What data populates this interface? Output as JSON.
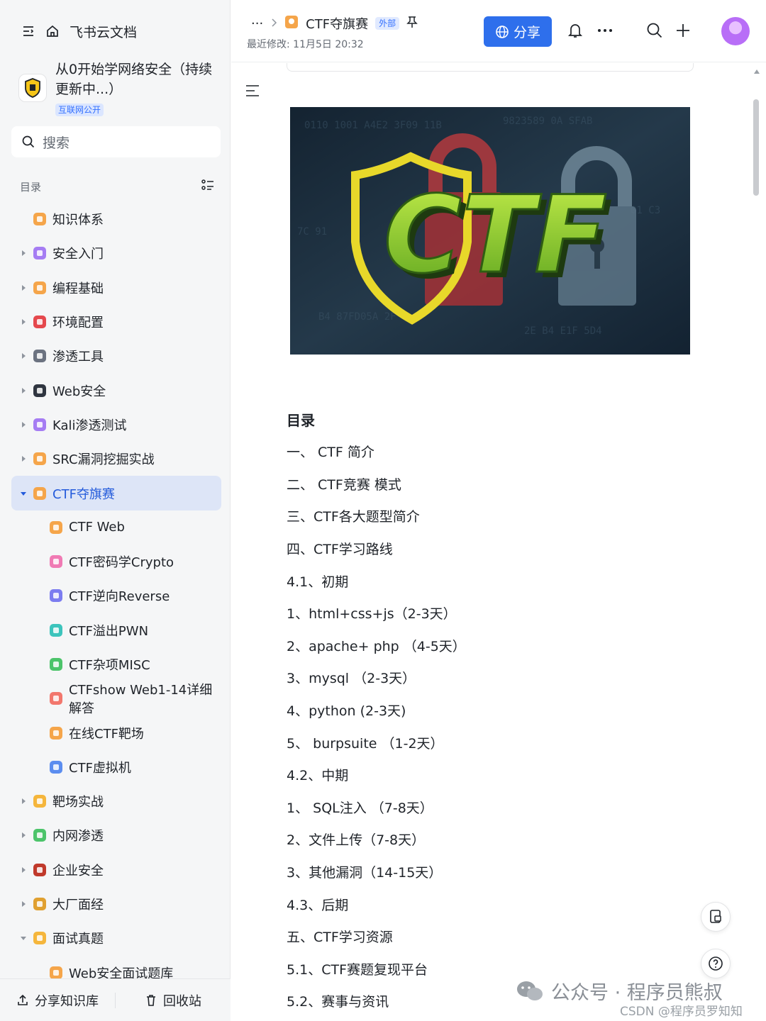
{
  "sidebar": {
    "home_label": "飞书云文档",
    "kb_title": "从0开始学网络安全（持续更新中...）",
    "kb_tag": "互联网公开",
    "search_placeholder": "搜索",
    "toc_label": "目录",
    "items": [
      {
        "label": "知识体系",
        "color": "#f5a54a",
        "arrow": "none",
        "indent": 0
      },
      {
        "label": "安全入门",
        "color": "#a57cf3",
        "arrow": "right",
        "indent": 0
      },
      {
        "label": "编程基础",
        "color": "#f5a54a",
        "arrow": "right",
        "indent": 0
      },
      {
        "label": "环境配置",
        "color": "#e5484d",
        "arrow": "right",
        "indent": 0
      },
      {
        "label": "渗透工具",
        "color": "#6b7280",
        "arrow": "right",
        "indent": 0
      },
      {
        "label": "Web安全",
        "color": "#2f3540",
        "arrow": "right",
        "indent": 0
      },
      {
        "label": "Kali渗透测试",
        "color": "#a57cf3",
        "arrow": "right",
        "indent": 0
      },
      {
        "label": "SRC漏洞挖掘实战",
        "color": "#f5a54a",
        "arrow": "right",
        "indent": 0
      },
      {
        "label": "CTF夺旗赛",
        "color": "#f5a54a",
        "arrow": "down",
        "indent": 0,
        "active": true
      },
      {
        "label": "CTF Web",
        "color": "#f5a54a",
        "arrow": "none",
        "indent": 1
      },
      {
        "label": "CTF密码学Crypto",
        "color": "#f07ab4",
        "arrow": "none",
        "indent": 1
      },
      {
        "label": "CTF逆向Reverse",
        "color": "#7b7cf0",
        "arrow": "none",
        "indent": 1
      },
      {
        "label": "CTF溢出PWN",
        "color": "#3cc4bc",
        "arrow": "none",
        "indent": 1
      },
      {
        "label": "CTF杂项MISC",
        "color": "#4cc46a",
        "arrow": "none",
        "indent": 1
      },
      {
        "label": "CTFshow Web1-14详细解答",
        "color": "#f2776d",
        "arrow": "none",
        "indent": 1
      },
      {
        "label": "在线CTF靶场",
        "color": "#f5a54a",
        "arrow": "none",
        "indent": 1
      },
      {
        "label": "CTF虚拟机",
        "color": "#5b8def",
        "arrow": "none",
        "indent": 1
      },
      {
        "label": "靶场实战",
        "color": "#f5b63c",
        "arrow": "right",
        "indent": 0
      },
      {
        "label": "内网渗透",
        "color": "#4cc46a",
        "arrow": "right",
        "indent": 0
      },
      {
        "label": "企业安全",
        "color": "#c0392b",
        "arrow": "right",
        "indent": 0
      },
      {
        "label": "大厂面经",
        "color": "#e0a030",
        "arrow": "right",
        "indent": 0
      },
      {
        "label": "面试真题",
        "color": "#f5b63c",
        "arrow": "down",
        "indent": 0
      },
      {
        "label": "Web安全面试题库",
        "color": "#f5a54a",
        "arrow": "none",
        "indent": 1
      }
    ],
    "share_kb_label": "分享知识库",
    "recycle_label": "回收站"
  },
  "header": {
    "crumb_more": "···",
    "doc_title": "CTF夺旗赛",
    "badge": "外部",
    "last_edit": "最近修改: 11月5日 20:32",
    "share_label": "分享"
  },
  "banner": {
    "text": "CTF",
    "colors": {
      "bg": "#1d2d3a",
      "shield": "#e8d82a",
      "letters": "#8dd12e"
    }
  },
  "doc": {
    "heading": "目录",
    "lines": [
      "一、 CTF 简介",
      "二、 CTF竞赛 模式",
      "三、CTF各大题型简介",
      "四、CTF学习路线",
      "4.1、初期",
      "1、html+css+js（2-3天）",
      "2、apache+ php （4-5天）",
      "3、mysql （2-3天）",
      "4、python (2-3天)",
      "5、 burpsuite （1-2天）",
      "4.2、中期",
      "1、 SQL注入 （7-8天）",
      "2、文件上传（7-8天）",
      "3、其他漏洞（14-15天）",
      "4.3、后期",
      "五、CTF学习资源",
      "5.1、CTF赛题复现平台",
      "5.2、赛事与资讯"
    ]
  },
  "watermark": {
    "text": "公众号 · 程序员熊叔",
    "csdn": "CSDN @程序员罗知知"
  },
  "colors": {
    "accent": "#2e6fec",
    "active_bg": "#dde5f7",
    "active_text": "#245bdb"
  }
}
